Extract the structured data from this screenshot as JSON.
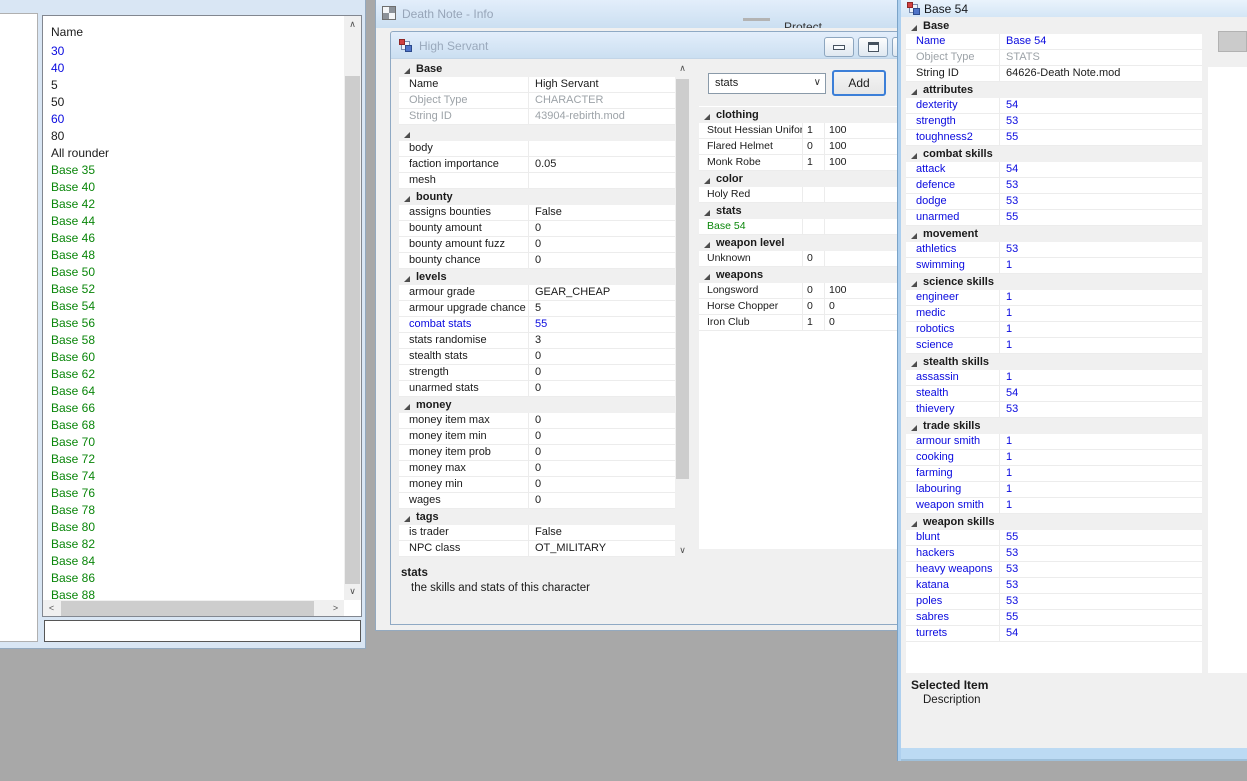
{
  "colors": {
    "blue": "#0a0adf",
    "green": "#0a860a",
    "gray": "#9da3a8",
    "black": "#1b1b1b"
  },
  "list_window": {
    "header": "Name",
    "filter_value": "",
    "items": [
      {
        "t": "30",
        "c": "blue"
      },
      {
        "t": "40",
        "c": "blue"
      },
      {
        "t": "5",
        "c": "black"
      },
      {
        "t": "50",
        "c": "black"
      },
      {
        "t": "60",
        "c": "blue"
      },
      {
        "t": "80",
        "c": "black"
      },
      {
        "t": "All rounder",
        "c": "black"
      },
      {
        "t": "Base 35",
        "c": "green"
      },
      {
        "t": "Base 40",
        "c": "green"
      },
      {
        "t": "Base 42",
        "c": "green"
      },
      {
        "t": "Base 44",
        "c": "green"
      },
      {
        "t": "Base 46",
        "c": "green"
      },
      {
        "t": "Base 48",
        "c": "green"
      },
      {
        "t": "Base 50",
        "c": "green"
      },
      {
        "t": "Base 52",
        "c": "green"
      },
      {
        "t": "Base 54",
        "c": "green"
      },
      {
        "t": "Base 56",
        "c": "green"
      },
      {
        "t": "Base 58",
        "c": "green"
      },
      {
        "t": "Base 60",
        "c": "green"
      },
      {
        "t": "Base 62",
        "c": "green"
      },
      {
        "t": "Base 64",
        "c": "green"
      },
      {
        "t": "Base 66",
        "c": "green"
      },
      {
        "t": "Base 68",
        "c": "green"
      },
      {
        "t": "Base 70",
        "c": "green"
      },
      {
        "t": "Base 72",
        "c": "green"
      },
      {
        "t": "Base 74",
        "c": "green"
      },
      {
        "t": "Base 76",
        "c": "green"
      },
      {
        "t": "Base 78",
        "c": "green"
      },
      {
        "t": "Base 80",
        "c": "green"
      },
      {
        "t": "Base 82",
        "c": "green"
      },
      {
        "t": "Base 84",
        "c": "green"
      },
      {
        "t": "Base 86",
        "c": "green"
      },
      {
        "t": "Base 88",
        "c": "green"
      }
    ]
  },
  "info_window": {
    "title": "Death Note - Info",
    "obscured_text": "Protect"
  },
  "hs": {
    "title": "High Servant",
    "combo_value": "stats",
    "add_label": "Add",
    "desc_title": "stats",
    "desc_text": "the skills and stats of this character",
    "grid": [
      {
        "label": "Base",
        "rows": [
          {
            "k": "Name",
            "v": "High Servant"
          },
          {
            "k": "Object Type",
            "v": "CHARACTER",
            "kc": "gray",
            "vc": "gray"
          },
          {
            "k": "String ID",
            "v": "43904-rebirth.mod",
            "kc": "gray",
            "vc": "gray"
          }
        ]
      },
      {
        "label": "",
        "rows": [
          {
            "k": "body",
            "v": ""
          },
          {
            "k": "faction importance",
            "v": "0.05"
          },
          {
            "k": "mesh",
            "v": ""
          }
        ]
      },
      {
        "label": "bounty",
        "rows": [
          {
            "k": "assigns bounties",
            "v": "False"
          },
          {
            "k": "bounty amount",
            "v": "0"
          },
          {
            "k": "bounty amount fuzz",
            "v": "0"
          },
          {
            "k": "bounty chance",
            "v": "0"
          }
        ]
      },
      {
        "label": "levels",
        "rows": [
          {
            "k": "armour grade",
            "v": "GEAR_CHEAP"
          },
          {
            "k": "armour upgrade chance",
            "v": "5"
          },
          {
            "k": "combat stats",
            "v": "55",
            "kc": "blue",
            "vc": "blue"
          },
          {
            "k": "stats randomise",
            "v": "3"
          },
          {
            "k": "stealth stats",
            "v": "0"
          },
          {
            "k": "strength",
            "v": "0"
          },
          {
            "k": "unarmed stats",
            "v": "0"
          }
        ]
      },
      {
        "label": "money",
        "rows": [
          {
            "k": "money item max",
            "v": "0"
          },
          {
            "k": "money item min",
            "v": "0"
          },
          {
            "k": "money item prob",
            "v": "0"
          },
          {
            "k": "money max",
            "v": "0"
          },
          {
            "k": "money min",
            "v": "0"
          },
          {
            "k": "wages",
            "v": "0"
          }
        ]
      },
      {
        "label": "tags",
        "rows": [
          {
            "k": "is trader",
            "v": "False"
          },
          {
            "k": "NPC class",
            "v": "OT_MILITARY"
          }
        ]
      }
    ],
    "right_grid": [
      {
        "label": "clothing",
        "rows": [
          {
            "n": "Stout Hessian Uniform",
            "a": "1",
            "b": "100"
          },
          {
            "n": "Flared Helmet",
            "a": "0",
            "b": "100"
          },
          {
            "n": "Monk Robe",
            "a": "1",
            "b": "100"
          }
        ]
      },
      {
        "label": "color",
        "rows": [
          {
            "n": "Holy Red",
            "a": "",
            "b": ""
          }
        ]
      },
      {
        "label": "stats",
        "rows": [
          {
            "n": "Base 54",
            "a": "",
            "b": "",
            "c": "green"
          }
        ]
      },
      {
        "label": "weapon level",
        "rows": [
          {
            "n": "Unknown",
            "a": "0",
            "b": ""
          }
        ]
      },
      {
        "label": "weapons",
        "rows": [
          {
            "n": "Longsword",
            "a": "0",
            "b": "100"
          },
          {
            "n": "Horse Chopper",
            "a": "0",
            "b": "0"
          },
          {
            "n": "Iron Club",
            "a": "1",
            "b": "0"
          }
        ]
      }
    ]
  },
  "base54": {
    "title": "Base 54",
    "footer_title": "Selected Item",
    "footer_text": "Description",
    "grid": [
      {
        "label": "Base",
        "rows": [
          {
            "k": "Name",
            "v": "Base 54"
          },
          {
            "k": "Object Type",
            "v": "STATS",
            "kc": "gray",
            "vc": "gray"
          },
          {
            "k": "String ID",
            "v": "64626-Death Note.mod",
            "kc": "black",
            "vc": "black"
          }
        ]
      },
      {
        "label": "attributes",
        "rows": [
          {
            "k": "dexterity",
            "v": "54"
          },
          {
            "k": "strength",
            "v": "53"
          },
          {
            "k": "toughness2",
            "v": "55"
          }
        ]
      },
      {
        "label": "combat skills",
        "rows": [
          {
            "k": "attack",
            "v": "54"
          },
          {
            "k": "defence",
            "v": "53"
          },
          {
            "k": "dodge",
            "v": "53"
          },
          {
            "k": "unarmed",
            "v": "55"
          }
        ]
      },
      {
        "label": "movement",
        "rows": [
          {
            "k": "athletics",
            "v": "53"
          },
          {
            "k": "swimming",
            "v": "1"
          }
        ]
      },
      {
        "label": "science skills",
        "rows": [
          {
            "k": "engineer",
            "v": "1"
          },
          {
            "k": "medic",
            "v": "1"
          },
          {
            "k": "robotics",
            "v": "1"
          },
          {
            "k": "science",
            "v": "1"
          }
        ]
      },
      {
        "label": "stealth skills",
        "rows": [
          {
            "k": "assassin",
            "v": "1"
          },
          {
            "k": "stealth",
            "v": "54"
          },
          {
            "k": "thievery",
            "v": "53"
          }
        ]
      },
      {
        "label": "trade skills",
        "rows": [
          {
            "k": "armour smith",
            "v": "1"
          },
          {
            "k": "cooking",
            "v": "1"
          },
          {
            "k": "farming",
            "v": "1"
          },
          {
            "k": "labouring",
            "v": "1"
          },
          {
            "k": "weapon smith",
            "v": "1"
          }
        ]
      },
      {
        "label": "weapon skills",
        "rows": [
          {
            "k": "blunt",
            "v": "55"
          },
          {
            "k": "hackers",
            "v": "53"
          },
          {
            "k": "heavy weapons",
            "v": "53"
          },
          {
            "k": "katana",
            "v": "53"
          },
          {
            "k": "poles",
            "v": "53"
          },
          {
            "k": "sabres",
            "v": "55"
          },
          {
            "k": "turrets",
            "v": "54"
          }
        ]
      }
    ]
  }
}
